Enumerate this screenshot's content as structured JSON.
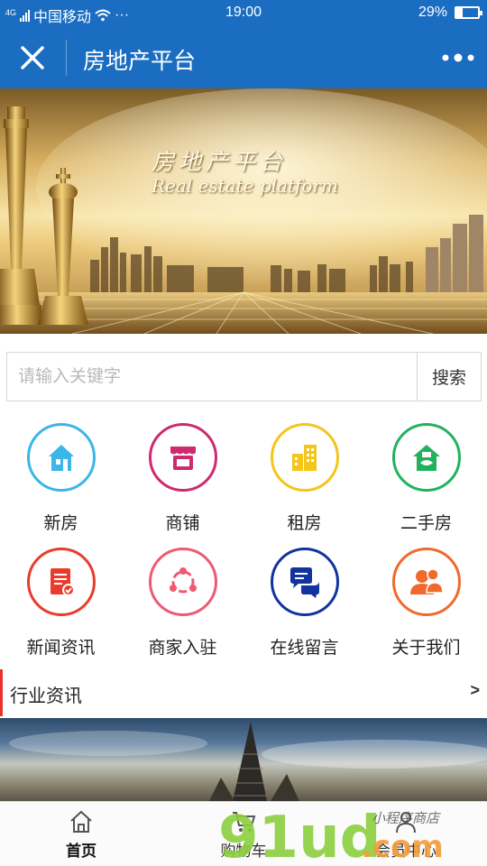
{
  "status_bar": {
    "network": "4G",
    "carrier": "中国移动",
    "more": "···",
    "time": "19:00",
    "battery_percent": "29%",
    "battery_level": 0.29
  },
  "title_bar": {
    "title": "房地产平台",
    "close_icon": "close-icon",
    "more_icon": "more-dots-icon"
  },
  "banner": {
    "title_cn": "房地产平台",
    "title_en": "Real estate platform"
  },
  "search": {
    "placeholder": "请输入关键字",
    "value": "",
    "button_label": "搜索"
  },
  "grid": [
    {
      "label": "新房",
      "icon": "new-house-icon",
      "color": "#3ab6e8"
    },
    {
      "label": "商铺",
      "icon": "shop-icon",
      "color": "#d02a6e"
    },
    {
      "label": "租房",
      "icon": "rent-building-icon",
      "color": "#f4c51b"
    },
    {
      "label": "二手房",
      "icon": "second-hand-house-icon",
      "color": "#22b25d"
    },
    {
      "label": "新闻资讯",
      "icon": "news-icon",
      "color": "#ea3b2e"
    },
    {
      "label": "商家入驻",
      "icon": "merchant-join-icon",
      "color": "#ef5a73"
    },
    {
      "label": "在线留言",
      "icon": "chat-bubbles-icon",
      "color": "#12339e"
    },
    {
      "label": "关于我们",
      "icon": "about-us-icon",
      "color": "#f06a2c"
    }
  ],
  "section": {
    "title": "行业资讯",
    "arrow": ">"
  },
  "tabbar": {
    "tabs": [
      {
        "label": "首页",
        "icon": "home-icon",
        "active": true
      },
      {
        "label": "购物车",
        "icon": "cart-icon",
        "active": false
      },
      {
        "label": "会员中心",
        "icon": "member-icon",
        "active": false
      }
    ]
  },
  "watermark": {
    "main": "91ud",
    "suffix": ".com",
    "tagline": "小程序商店"
  },
  "colors": {
    "primary": "#1b6dc1",
    "section_accent": "#e8322b"
  }
}
